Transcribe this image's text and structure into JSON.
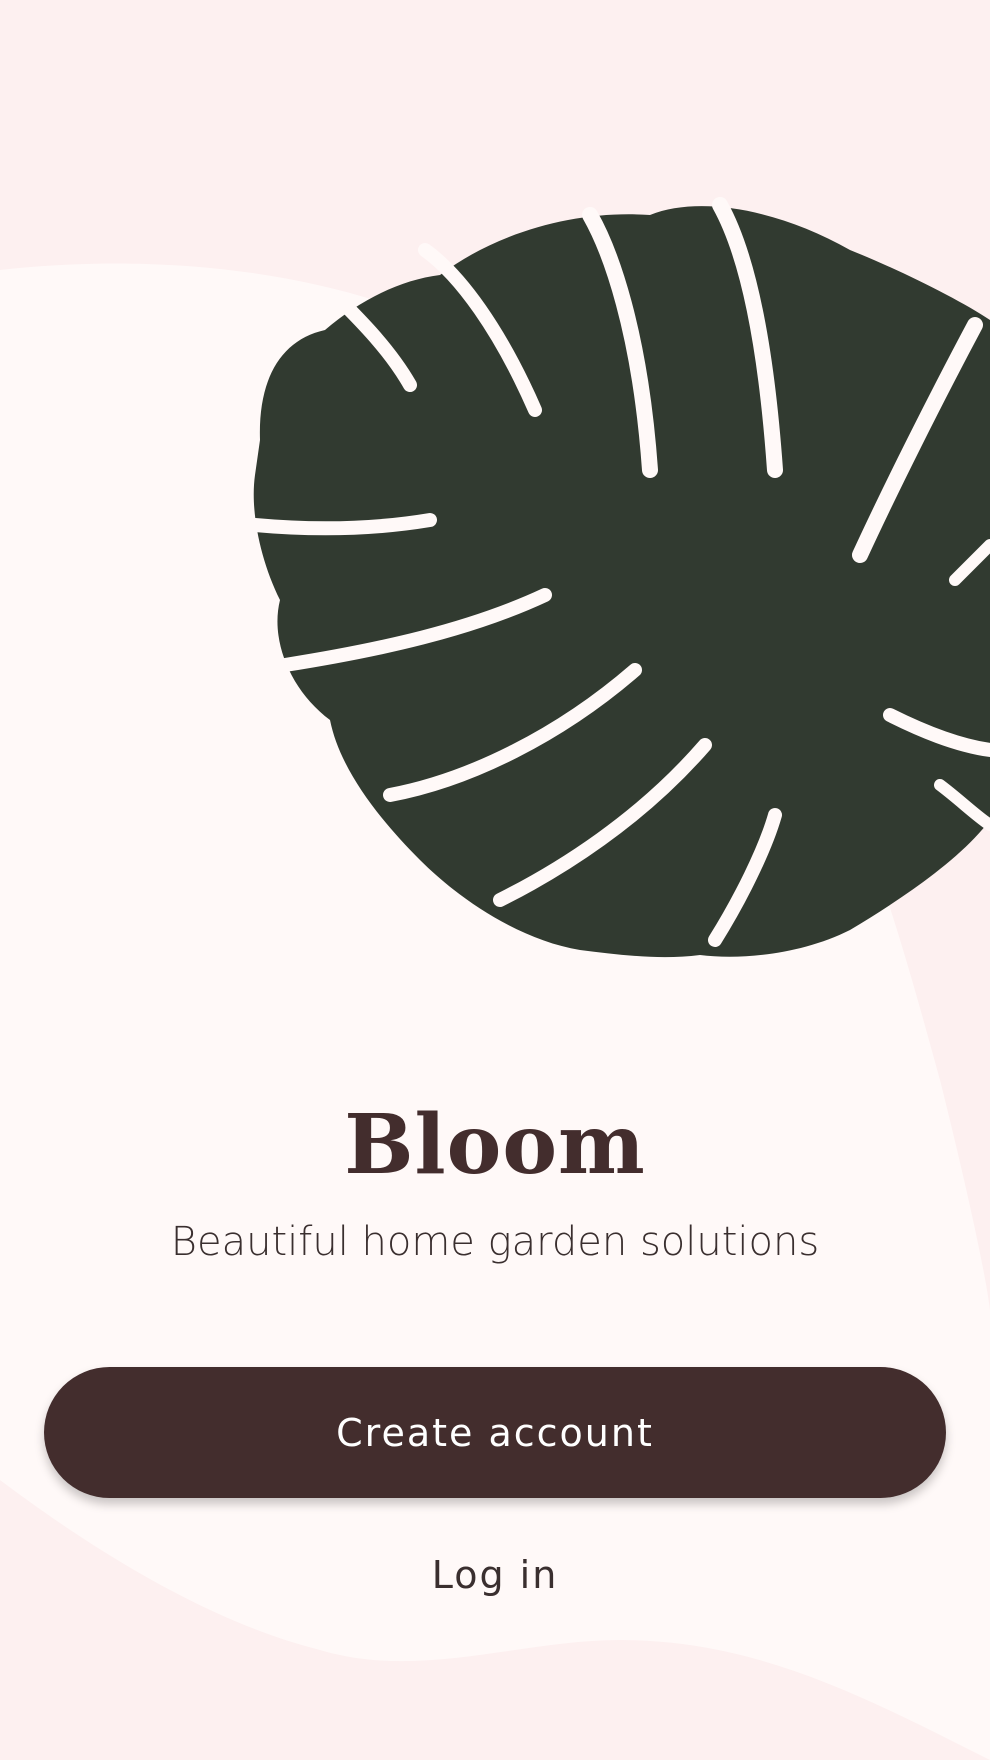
{
  "brand": {
    "title": "Bloom",
    "tagline": "Beautiful home garden solutions"
  },
  "actions": {
    "create_account_label": "Create account",
    "login_label": "Log in"
  },
  "illustration": {
    "icon": "monstera-leaf-icon"
  },
  "colors": {
    "background": "#fdf0f0",
    "panel": "#fff9f8",
    "leaf": "#313a30",
    "primary": "#432d2d",
    "text": "#3a2f2f",
    "button_text": "#ffffff"
  }
}
